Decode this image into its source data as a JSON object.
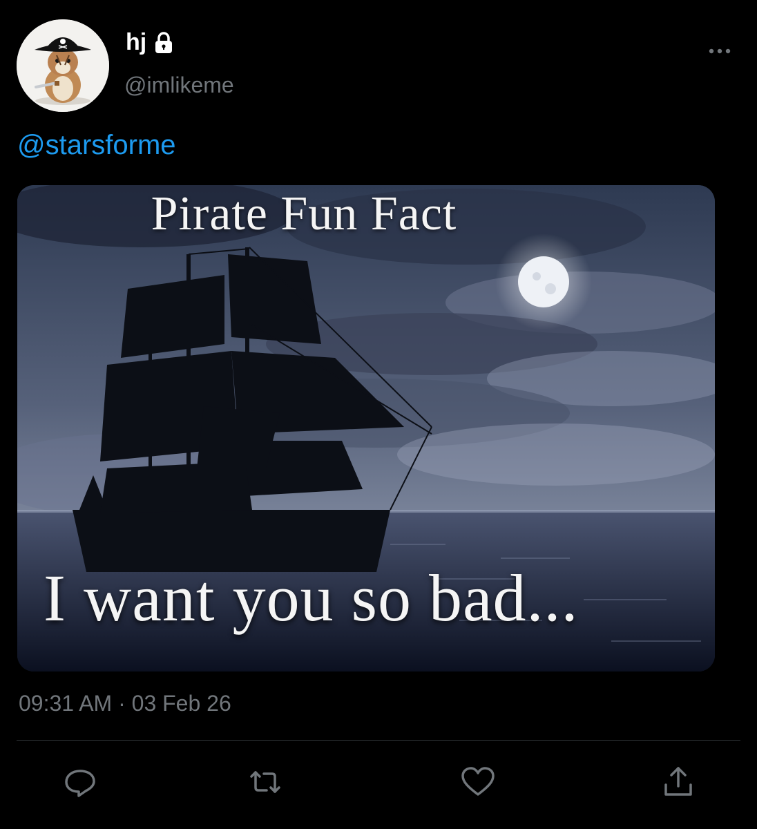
{
  "tweet": {
    "display_name": "hj",
    "handle": "@imlikeme",
    "protected_icon": "lock-icon",
    "mention": "@starsforme",
    "time": "09:31 AM",
    "separator": "·",
    "date": "03 Feb 26"
  },
  "media": {
    "top_caption": "Pirate Fun Fact",
    "bottom_caption": "I want you so bad..."
  },
  "actions": [
    {
      "icon": "reply-icon"
    },
    {
      "icon": "retweet-icon"
    },
    {
      "icon": "like-icon"
    },
    {
      "icon": "share-icon"
    }
  ],
  "colors": {
    "background": "#000000",
    "link": "#1d9bf0",
    "secondary_text": "#71767b",
    "divider": "#2f3336"
  }
}
